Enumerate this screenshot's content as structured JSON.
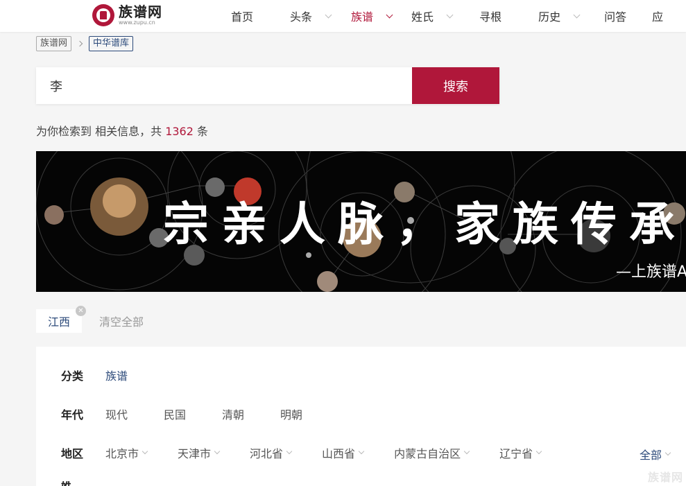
{
  "header": {
    "logo": {
      "name": "族谱网",
      "domain": "www.zupu.cn"
    },
    "nav": [
      {
        "label": "首页",
        "dropdown": false,
        "active": false
      },
      {
        "label": "头条",
        "dropdown": true,
        "active": false
      },
      {
        "label": "族谱",
        "dropdown": true,
        "active": true
      },
      {
        "label": "姓氏",
        "dropdown": true,
        "active": false
      },
      {
        "label": "寻根",
        "dropdown": false,
        "active": false
      },
      {
        "label": "历史",
        "dropdown": true,
        "active": false
      },
      {
        "label": "问答",
        "dropdown": false,
        "active": false
      },
      {
        "label": "应",
        "dropdown": false,
        "active": false
      }
    ]
  },
  "breadcrumb": [
    "族谱网",
    "中华谱库"
  ],
  "search": {
    "value": "李",
    "button": "搜索"
  },
  "result": {
    "prefix": "为你检索到 相关信息，共",
    "count": "1362",
    "suffix": "条"
  },
  "banner": {
    "title": "宗亲人脉，家族传承",
    "subtitle": "—上族谱App"
  },
  "active_filters": {
    "tags": [
      "江西"
    ],
    "clear_all": "清空全部"
  },
  "filters": {
    "category": {
      "label": "分类",
      "options": [
        "族谱"
      ]
    },
    "era": {
      "label": "年代",
      "options": [
        "现代",
        "民国",
        "清朝",
        "明朝"
      ]
    },
    "region": {
      "label": "地区",
      "options": [
        "北京市",
        "天津市",
        "河北省",
        "山西省",
        "内蒙古自治区",
        "辽宁省"
      ],
      "all": "全部"
    },
    "next_label": "姓"
  },
  "watermark": "族谱网",
  "colors": {
    "accent": "#b0173a",
    "link": "#2c4a7a"
  }
}
